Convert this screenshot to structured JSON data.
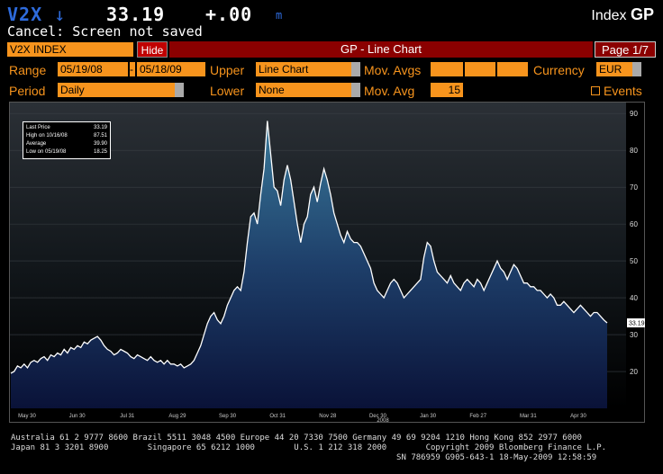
{
  "header": {
    "ticker": "V2X",
    "arrow": "↓",
    "price": "33.19",
    "change": "+.00",
    "change_unit": "m",
    "index_label": "Index",
    "function_code": "GP"
  },
  "status_message": "Cancel: Screen not saved",
  "toolbar": {
    "security": "V2X INDEX",
    "hide_label": "Hide",
    "title": "GP - Line Chart",
    "page": "Page 1/7"
  },
  "controls": {
    "range_label": "Range",
    "range_start": "05/19/08",
    "range_sep": "-",
    "range_end": "05/18/09",
    "upper_label": "Upper",
    "upper_value": "Line Chart",
    "mov_avgs_label": "Mov. Avgs",
    "currency_label": "Currency",
    "currency_value": "EUR",
    "period_label": "Period",
    "period_value": "Daily",
    "lower_label": "Lower",
    "lower_value": "None",
    "mov_avg_label": "Mov. Avg",
    "mov_avg_value": "15",
    "events_label": "Events"
  },
  "legend": {
    "rows": [
      {
        "label": "Last Price",
        "value": "33.19"
      },
      {
        "label": "High on 10/16/08",
        "value": "87.51"
      },
      {
        "label": "Average",
        "value": "39.90"
      },
      {
        "label": "Low on 05/19/08",
        "value": "18.25"
      }
    ]
  },
  "chart_data": {
    "type": "area",
    "y_ticks": [
      20,
      30,
      40,
      50,
      60,
      70,
      80,
      90
    ],
    "ylim": [
      10,
      92
    ],
    "x_labels": [
      "May 30",
      "Jun 30",
      "Jul 31",
      "Aug 29",
      "Sep 30",
      "Oct 31",
      "Nov 28",
      "Dec 30",
      "Jan 30",
      "Feb 27",
      "Mar 31",
      "Apr 30"
    ],
    "year_label": "2008",
    "last_value_label": "33.19",
    "series": [
      {
        "values": [
          19.5,
          20,
          21.5,
          21,
          22,
          21,
          22.5,
          23,
          22.5,
          23.5,
          24,
          23,
          24.5,
          24,
          25,
          24.5,
          26,
          25,
          26.5,
          26,
          27,
          26.5,
          28,
          27.5,
          28.5,
          29,
          29.5,
          28.5,
          27,
          26,
          25.5,
          24.5,
          25,
          26,
          25.5,
          25,
          24,
          23.5,
          24.5,
          24,
          23.5,
          23,
          24,
          23,
          22.5,
          23,
          22,
          23,
          22,
          22,
          21.5,
          22,
          21,
          21.5,
          22,
          23,
          25,
          27,
          30,
          33,
          35,
          36,
          34,
          33,
          35,
          38,
          40,
          42,
          43,
          42,
          47,
          55,
          62,
          63,
          60,
          68,
          75,
          88,
          79,
          70,
          69,
          65,
          72,
          76,
          72,
          66,
          60,
          55,
          60,
          62,
          68,
          70,
          66,
          71,
          75,
          72,
          68,
          63,
          60,
          57,
          55,
          58,
          56,
          55,
          55,
          54,
          52,
          50,
          48,
          44,
          42,
          41,
          40,
          42,
          44,
          45,
          44,
          42,
          40,
          41,
          42,
          43,
          44,
          45,
          51,
          55,
          54,
          50,
          47,
          46,
          45,
          44,
          46,
          44,
          43,
          42,
          44,
          45,
          44,
          43,
          45,
          44,
          42,
          44,
          46,
          48,
          50,
          48,
          47,
          45,
          47,
          49,
          48,
          46,
          44,
          44,
          43,
          43,
          42,
          42,
          41,
          40,
          41,
          40,
          38,
          38,
          39,
          38,
          37,
          36,
          37,
          38,
          37,
          36,
          35,
          36,
          36,
          35,
          34,
          33.19
        ]
      }
    ]
  },
  "footer": {
    "line1": "Australia 61 2 9777 8600 Brazil 5511 3048 4500 Europe 44 20 7330 7500 Germany 49 69 9204 1210 Hong Kong 852 2977 6000",
    "line2": "Japan 81 3 3201 8900        Singapore 65 6212 1000        U.S. 1 212 318 2000        Copyright 2009 Bloomberg Finance L.P.",
    "line3": "                                                                               SN 786959 G905-643-1 18-May-2009 12:58:59"
  },
  "colors": {
    "field_orange": "#f7941d",
    "title_red": "#8b0000",
    "ticker_blue": "#2e6bdc"
  }
}
